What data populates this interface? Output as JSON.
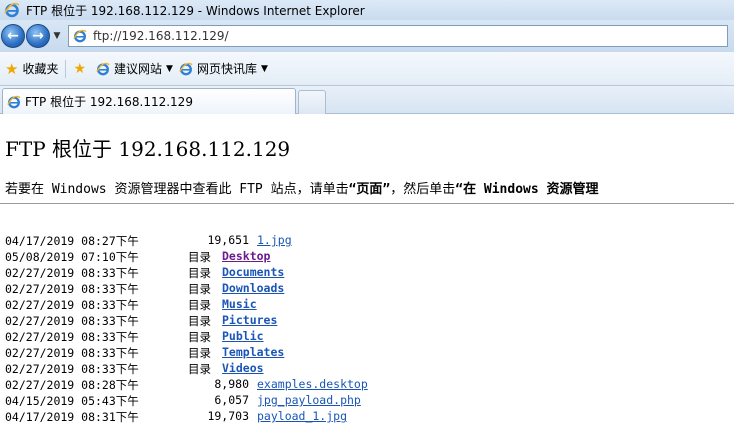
{
  "window": {
    "title": "FTP 根位于 192.168.112.129 - Windows Internet Explorer"
  },
  "address": {
    "url": "ftp://192.168.112.129/"
  },
  "favorites": {
    "favorites_label": "收藏夹",
    "suggested_sites_label": "建议网站",
    "web_slice_label": "网页快讯库"
  },
  "tabs": [
    {
      "label": "FTP 根位于 192.168.112.129"
    }
  ],
  "page": {
    "title": "FTP 根位于 192.168.112.129",
    "instruction_prefix": "若要在 Windows 资源管理器中查看此 FTP 站点，请单击",
    "instruction_page": "“页面”",
    "instruction_middle": "，然后单击",
    "instruction_suffix": "“在 Windows 资源管理"
  },
  "listing": [
    {
      "date": "04/17/2019 08:27下午",
      "size": "19,651",
      "is_dir": false,
      "name": "1.jpg"
    },
    {
      "date": "05/08/2019 07:10下午",
      "size": "目录",
      "is_dir": true,
      "name": "Desktop",
      "visited": true
    },
    {
      "date": "02/27/2019 08:33下午",
      "size": "目录",
      "is_dir": true,
      "name": "Documents"
    },
    {
      "date": "02/27/2019 08:33下午",
      "size": "目录",
      "is_dir": true,
      "name": "Downloads"
    },
    {
      "date": "02/27/2019 08:33下午",
      "size": "目录",
      "is_dir": true,
      "name": "Music"
    },
    {
      "date": "02/27/2019 08:33下午",
      "size": "目录",
      "is_dir": true,
      "name": "Pictures"
    },
    {
      "date": "02/27/2019 08:33下午",
      "size": "目录",
      "is_dir": true,
      "name": "Public"
    },
    {
      "date": "02/27/2019 08:33下午",
      "size": "目录",
      "is_dir": true,
      "name": "Templates"
    },
    {
      "date": "02/27/2019 08:33下午",
      "size": "目录",
      "is_dir": true,
      "name": "Videos"
    },
    {
      "date": "02/27/2019 08:28下午",
      "size": "8,980",
      "is_dir": false,
      "name": "examples.desktop"
    },
    {
      "date": "04/15/2019 05:43下午",
      "size": "6,057",
      "is_dir": false,
      "name": "jpg_payload.php"
    },
    {
      "date": "04/17/2019 08:31下午",
      "size": "19,703",
      "is_dir": false,
      "name": "payload_1.jpg"
    }
  ]
}
